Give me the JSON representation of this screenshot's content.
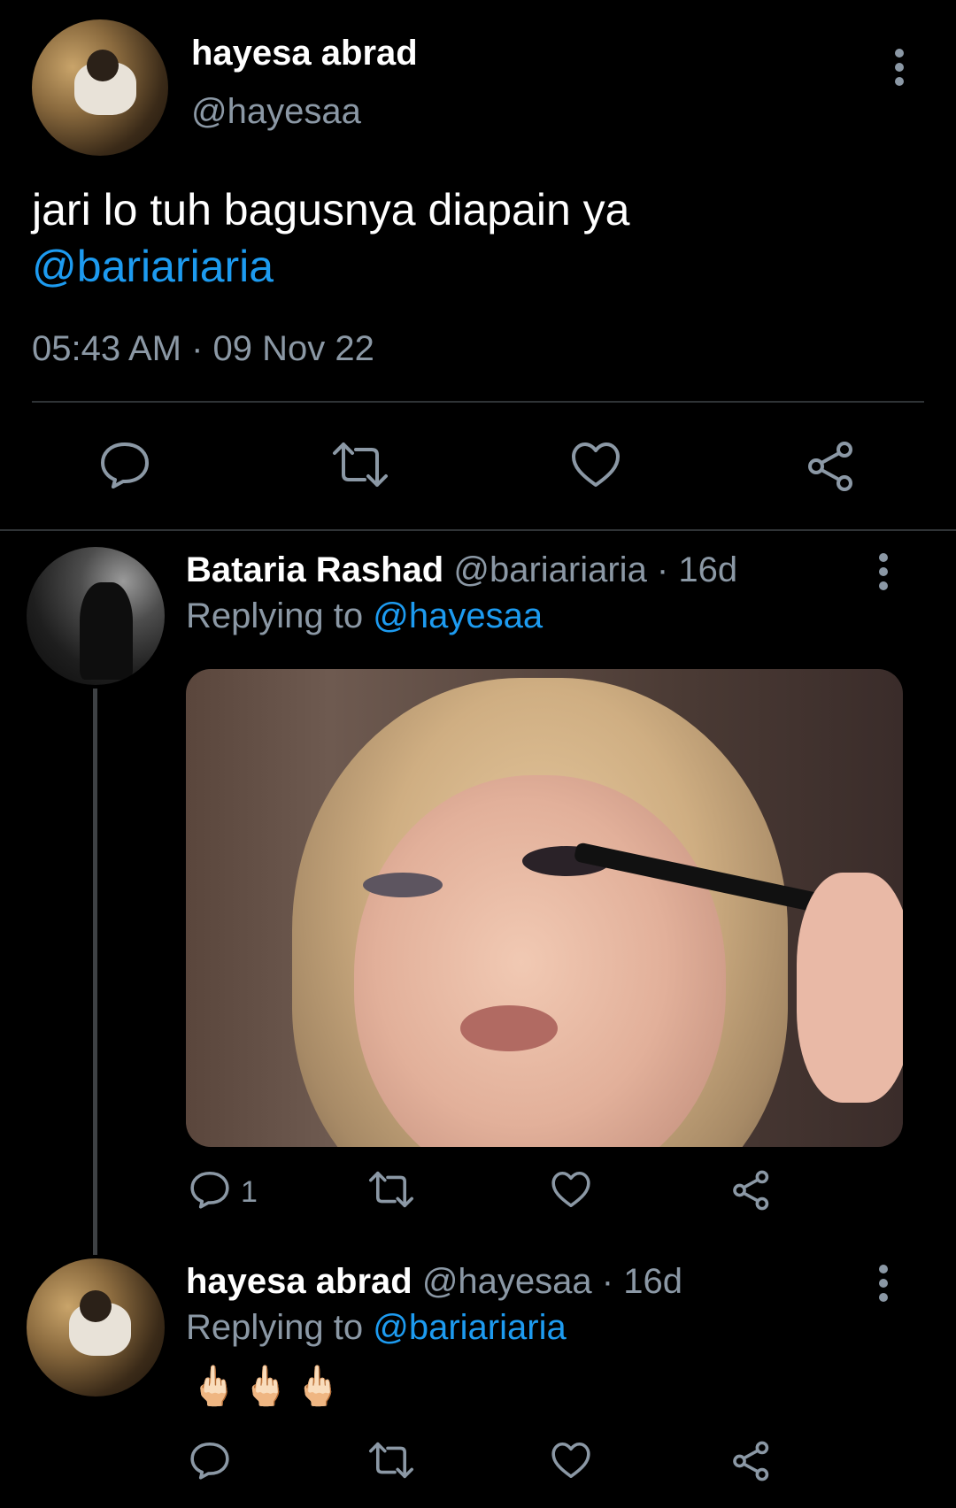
{
  "main_tweet": {
    "author_name": "hayesa abrad",
    "author_handle": "@hayesaa",
    "text_line1": "jari lo tuh bagusnya diapain ya",
    "mention": "@bariariaria",
    "timestamp": "05:43 AM · 09 Nov 22"
  },
  "reply1": {
    "author_name": "Bataria Rashad",
    "handle_time": "@bariariaria · 16d",
    "replying_prefix": "Replying to",
    "replying_to": "@hayesaa",
    "reply_count": "1"
  },
  "reply2": {
    "author_name": "hayesa abrad",
    "handle_time": "@hayesaa · 16d",
    "replying_prefix": "Replying to",
    "replying_to": "@bariariaria",
    "text": "🖕🏻🖕🏻🖕🏻"
  },
  "icons": [
    "more-vertical-icon",
    "reply-icon",
    "retweet-icon",
    "like-icon",
    "share-icon"
  ],
  "colors": {
    "background": "#000000",
    "link": "#1d9bf0",
    "muted": "#8b98a5",
    "divider": "#2f3336"
  }
}
